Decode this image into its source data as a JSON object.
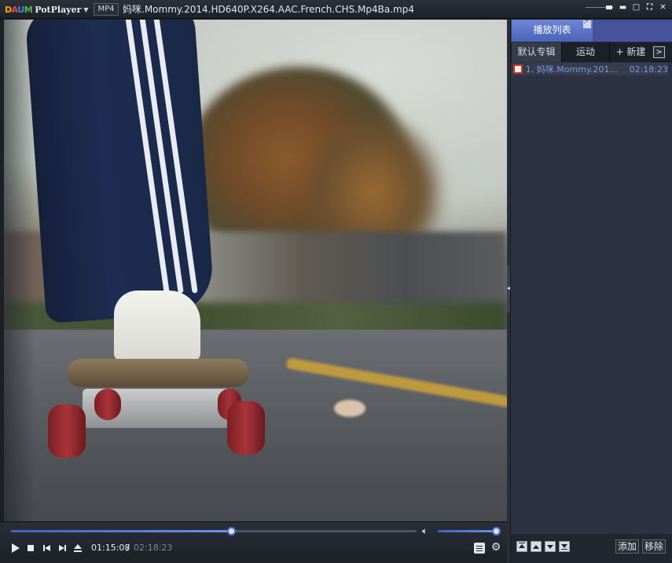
{
  "titlebar": {
    "logo_brand": [
      "D",
      "A",
      "U",
      "M"
    ],
    "logo_product": "PotPlayer",
    "format_badge": "MP4",
    "file_title": "妈咪.Mommy.2014.HD640P.X264.AAC.French.CHS.Mp4Ba.mp4",
    "min_symbol": "▬",
    "max_symbol": "□",
    "close_symbol": "✕",
    "fullscreen_symbol": "⛶"
  },
  "player": {
    "current_time": "01:15:08",
    "separator": "/",
    "total_time": "02:18:23",
    "progress_fraction": 0.543,
    "volume_fraction": 1.0,
    "accent_color": "#4a72d8"
  },
  "playlist": {
    "header_tab": "播放列表",
    "albums": [
      "默认专辑",
      "运动",
      "+ 新建"
    ],
    "next_arrow": ">",
    "items": [
      {
        "index": "1.",
        "name": "妈咪.Mommy.201...",
        "duration": "02:18:23"
      }
    ],
    "add_label": "添加",
    "remove_label": "移除"
  }
}
